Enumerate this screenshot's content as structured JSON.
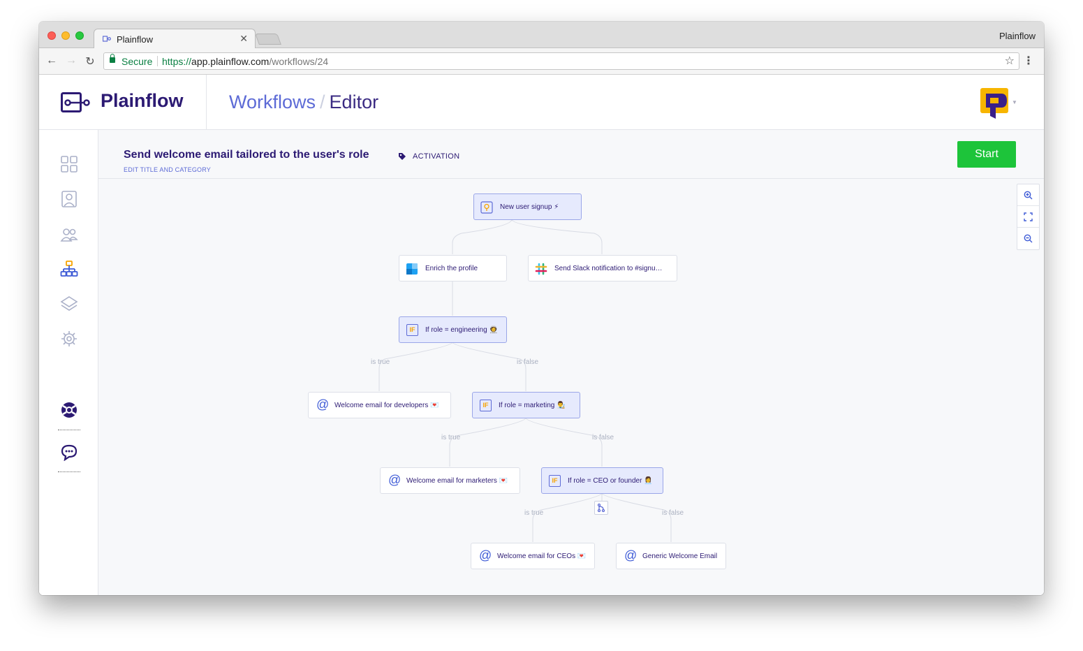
{
  "browser": {
    "tab_title": "Plainflow",
    "profile_name": "Plainflow",
    "secure_label": "Secure",
    "url_scheme": "https://",
    "url_host": "app.plainflow.com",
    "url_path": "/workflows/24"
  },
  "header": {
    "brand": "Plainflow",
    "breadcrumb_root": "Workflows",
    "breadcrumb_sep": "/",
    "breadcrumb_current": "Editor"
  },
  "sidebar": {
    "items": [
      {
        "icon": "dashboard-grid-icon"
      },
      {
        "icon": "user-profile-icon"
      },
      {
        "icon": "users-group-icon"
      },
      {
        "icon": "workflow-hierarchy-icon"
      },
      {
        "icon": "layers-icon"
      },
      {
        "icon": "gear-icon"
      },
      {
        "icon": "lifebuoy-help-icon"
      },
      {
        "icon": "chat-bubble-icon"
      }
    ]
  },
  "workflow": {
    "title": "Send welcome email tailored to the user's role",
    "edit_link": "EDIT TITLE AND CATEGORY",
    "category": "ACTIVATION",
    "start_label": "Start"
  },
  "nodes": {
    "trigger": "New user signup ⚡",
    "enrich": "Enrich the profile",
    "slack": "Send Slack notification to #signu…",
    "if_engineering": "If role = engineering 👩‍🚀",
    "email_developers": "Welcome email for developers 💌",
    "if_marketing": "If role = marketing 👨‍🎨",
    "email_marketers": "Welcome email for marketers 💌",
    "if_ceo": "If role = CEO or founder 👩‍💼",
    "email_ceos": "Welcome email for CEOs 💌",
    "email_generic": "Generic Welcome Email"
  },
  "edges": {
    "true_label": "is true",
    "false_label": "is false"
  },
  "colors": {
    "brand": "#2c1a73",
    "accent": "#5d6bd6",
    "start": "#1dc43a",
    "node_highlight": "#e6eafd"
  }
}
